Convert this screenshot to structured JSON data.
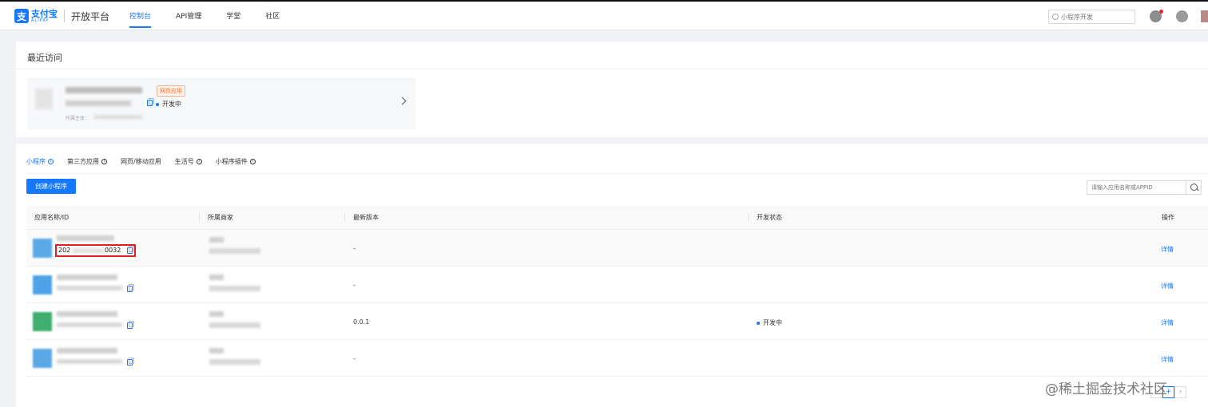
{
  "header": {
    "logo_cn": "支付宝",
    "logo_en": "ALIPAY",
    "platform_title": "开放平台",
    "nav": [
      {
        "label": "控制台",
        "active": true
      },
      {
        "label": "API管理",
        "active": false
      },
      {
        "label": "学堂",
        "active": false
      },
      {
        "label": "社区",
        "active": false
      }
    ],
    "search_placeholder": "小程序开发"
  },
  "recent": {
    "title": "最近访问",
    "item": {
      "tag": "网页应用",
      "status": "开发中",
      "owner_label": "所属主体："
    }
  },
  "main": {
    "tabs": [
      {
        "label": "小程序",
        "active": true,
        "info": true
      },
      {
        "label": "第三方应用",
        "active": false,
        "info": true
      },
      {
        "label": "网页/移动应用",
        "active": false,
        "info": false
      },
      {
        "label": "生活号",
        "active": false,
        "info": true
      },
      {
        "label": "小程序插件",
        "active": false,
        "info": true
      }
    ],
    "create_button": "创建小程序",
    "search_placeholder": "请输入应用名称或APPID",
    "columns": [
      "应用名称/ID",
      "所属商家",
      "最新版本",
      "开发状态",
      "操作"
    ],
    "rows": [
      {
        "id_prefix": "202",
        "id_suffix": "0032",
        "version": "-",
        "status": "",
        "action": "详情",
        "thumb_color": "#5aa9e6"
      },
      {
        "id_prefix": "",
        "id_suffix": "",
        "version": "-",
        "status": "",
        "action": "详情",
        "thumb_color": "#4ea3e8"
      },
      {
        "id_prefix": "",
        "id_suffix": "",
        "version": "0.0.1",
        "status": "开发中",
        "action": "详情",
        "thumb_color": "#3fae6e"
      },
      {
        "id_prefix": "",
        "id_suffix": "",
        "version": "-",
        "status": "",
        "action": "详情",
        "thumb_color": "#5aa9e6"
      }
    ]
  },
  "watermark": "@稀土掘金技术社区",
  "colors": {
    "accent": "#1677ff",
    "highlight_box": "#e02020",
    "tag_orange": "#f56c2d"
  }
}
